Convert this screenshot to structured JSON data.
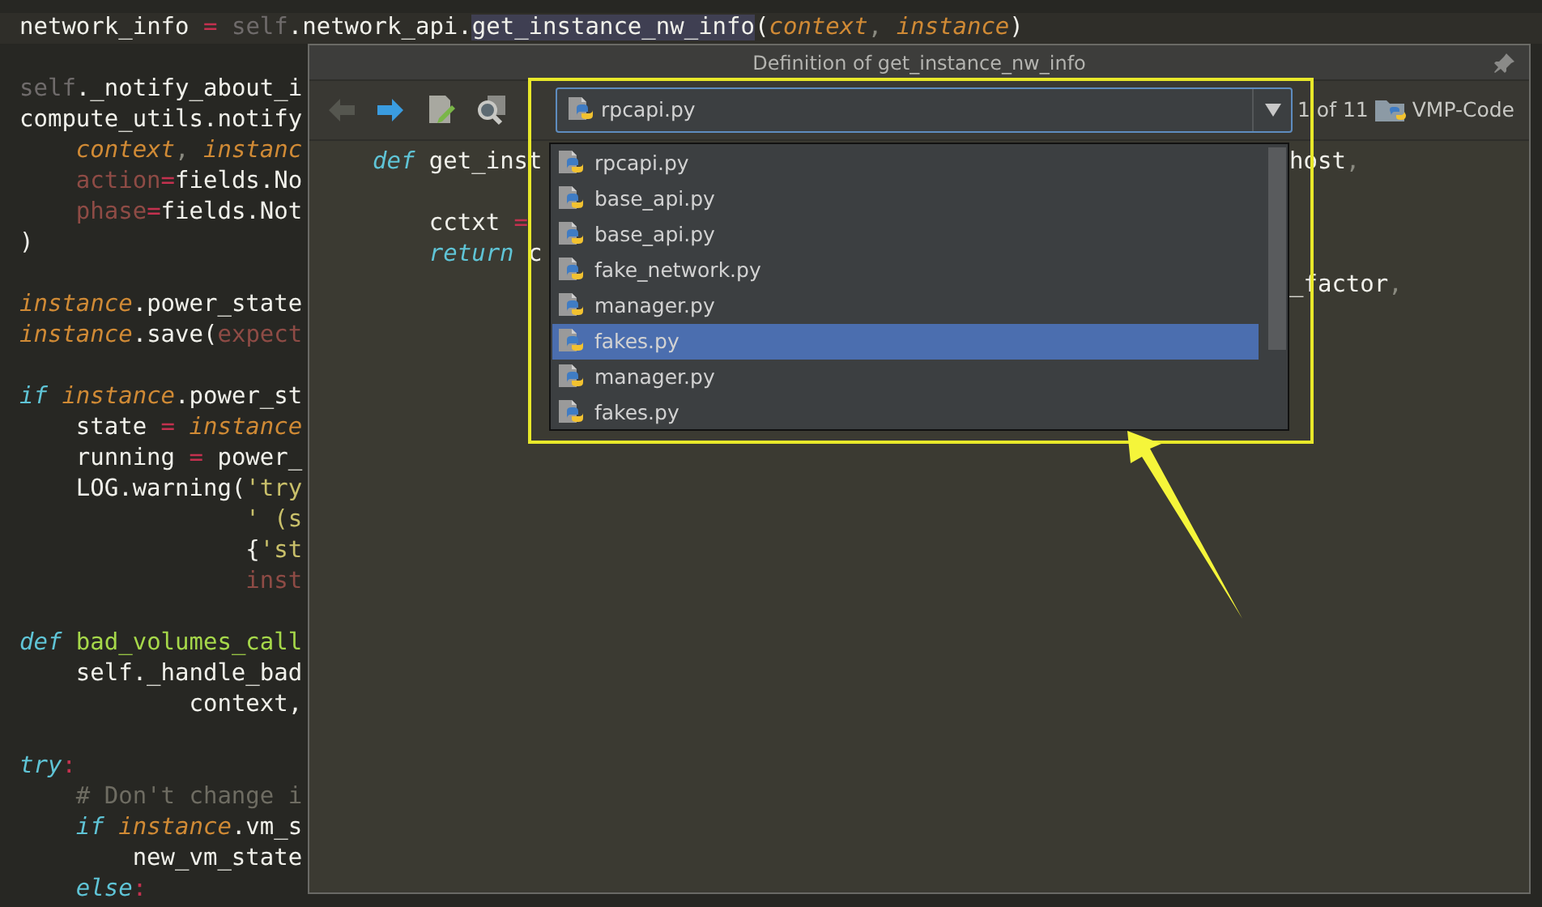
{
  "editor": {
    "lines": [
      [
        {
          "kind": "plain",
          "text": "network_info "
        },
        {
          "kind": "op",
          "text": "= "
        },
        {
          "kind": "self",
          "text": "self"
        },
        {
          "kind": "plain",
          "text": ".network_api."
        },
        {
          "kind": "highlight",
          "text": "get_instance_nw_info"
        },
        {
          "kind": "plain",
          "text": "("
        },
        {
          "kind": "param",
          "text": "context"
        },
        {
          "kind": "punct",
          "text": ", "
        },
        {
          "kind": "param",
          "text": "instance"
        },
        {
          "kind": "plain",
          "text": ")"
        }
      ],
      [
        {
          "kind": "self",
          "text": "self"
        },
        {
          "kind": "plain",
          "text": "._notify_about_i"
        }
      ],
      [
        {
          "kind": "plain",
          "text": "compute_utils.notify"
        }
      ],
      [
        {
          "kind": "param",
          "text": "context"
        },
        {
          "kind": "punct",
          "text": ", "
        },
        {
          "kind": "param",
          "text": "instanc"
        }
      ],
      [
        {
          "kind": "kwarg",
          "text": "action"
        },
        {
          "kind": "op",
          "text": "="
        },
        {
          "kind": "plain",
          "text": "fields.No"
        }
      ],
      [
        {
          "kind": "kwarg",
          "text": "phase"
        },
        {
          "kind": "op",
          "text": "="
        },
        {
          "kind": "plain",
          "text": "fields.Not"
        }
      ],
      [
        {
          "kind": "plain",
          "text": ")"
        }
      ],
      [
        {
          "kind": "param",
          "text": "instance"
        },
        {
          "kind": "plain",
          "text": ".power_state"
        }
      ],
      [
        {
          "kind": "param",
          "text": "instance"
        },
        {
          "kind": "plain",
          "text": ".save("
        },
        {
          "kind": "kwarg",
          "text": "expect"
        }
      ],
      [
        {
          "kind": "keyword",
          "text": "if "
        },
        {
          "kind": "param",
          "text": "instance"
        },
        {
          "kind": "plain",
          "text": ".power_st"
        }
      ],
      [
        {
          "kind": "plain",
          "text": "state "
        },
        {
          "kind": "op",
          "text": "= "
        },
        {
          "kind": "param",
          "text": "instance"
        }
      ],
      [
        {
          "kind": "plain",
          "text": "running "
        },
        {
          "kind": "op",
          "text": "= "
        },
        {
          "kind": "plain",
          "text": "power_"
        }
      ],
      [
        {
          "kind": "plain",
          "text": "LOG.warning("
        },
        {
          "kind": "string",
          "text": "'try"
        }
      ],
      [
        {
          "kind": "string",
          "text": "' (s"
        }
      ],
      [
        {
          "kind": "plain",
          "text": "{"
        },
        {
          "kind": "string",
          "text": "'st"
        }
      ],
      [
        {
          "kind": "kwarg",
          "text": "inst"
        }
      ],
      [
        {
          "kind": "keyword",
          "text": "def "
        },
        {
          "kind": "funcname",
          "text": "bad_volumes_call"
        }
      ],
      [
        {
          "kind": "plain",
          "text": "self._handle_bad"
        }
      ],
      [
        {
          "kind": "plain",
          "text": "context,"
        }
      ],
      [
        {
          "kind": "keyword",
          "text": "try"
        },
        {
          "kind": "op",
          "text": ":"
        }
      ],
      [
        {
          "kind": "comment",
          "text": "# Don't change i"
        }
      ],
      [
        {
          "kind": "keyword",
          "text": "if "
        },
        {
          "kind": "param",
          "text": "instance"
        },
        {
          "kind": "plain",
          "text": ".vm_s"
        }
      ],
      [
        {
          "kind": "plain",
          "text": "new_vm_state"
        }
      ],
      [
        {
          "kind": "keyword",
          "text": "else"
        },
        {
          "kind": "op",
          "text": ":"
        }
      ]
    ]
  },
  "popup": {
    "title": "Definition of get_instance_nw_info",
    "toolbar": {
      "back_disabled": true,
      "forward_disabled": false,
      "combo_value": "rpcapi.py",
      "position": "1 of 11",
      "project": "VMP-Code"
    },
    "dropdown": {
      "items": [
        {
          "label": "rpcapi.py",
          "selected": false
        },
        {
          "label": "base_api.py",
          "selected": false
        },
        {
          "label": "base_api.py",
          "selected": false
        },
        {
          "label": "fake_network.py",
          "selected": false
        },
        {
          "label": "manager.py",
          "selected": false
        },
        {
          "label": "fakes.py",
          "selected": true
        },
        {
          "label": "manager.py",
          "selected": false
        },
        {
          "label": "fakes.py",
          "selected": false
        }
      ]
    },
    "lines": [
      {
        "left": [
          {
            "kind": "keyword",
            "text": "def "
          },
          {
            "kind": "plain",
            "text": "get_inst"
          }
        ],
        "right": [
          {
            "kind": "plain",
            "text": "host"
          },
          {
            "kind": "punct",
            "text": ","
          }
        ]
      },
      {
        "left": [
          {
            "kind": "plain",
            "text": "cctxt "
          },
          {
            "kind": "op",
            "text": "="
          }
        ]
      },
      {
        "left": [
          {
            "kind": "keyword",
            "text": "return "
          },
          {
            "kind": "plain",
            "text": "c"
          }
        ]
      },
      {
        "right": [
          {
            "kind": "plain",
            "text": "_factor"
          },
          {
            "kind": "punct",
            "text": ","
          }
        ]
      }
    ]
  }
}
